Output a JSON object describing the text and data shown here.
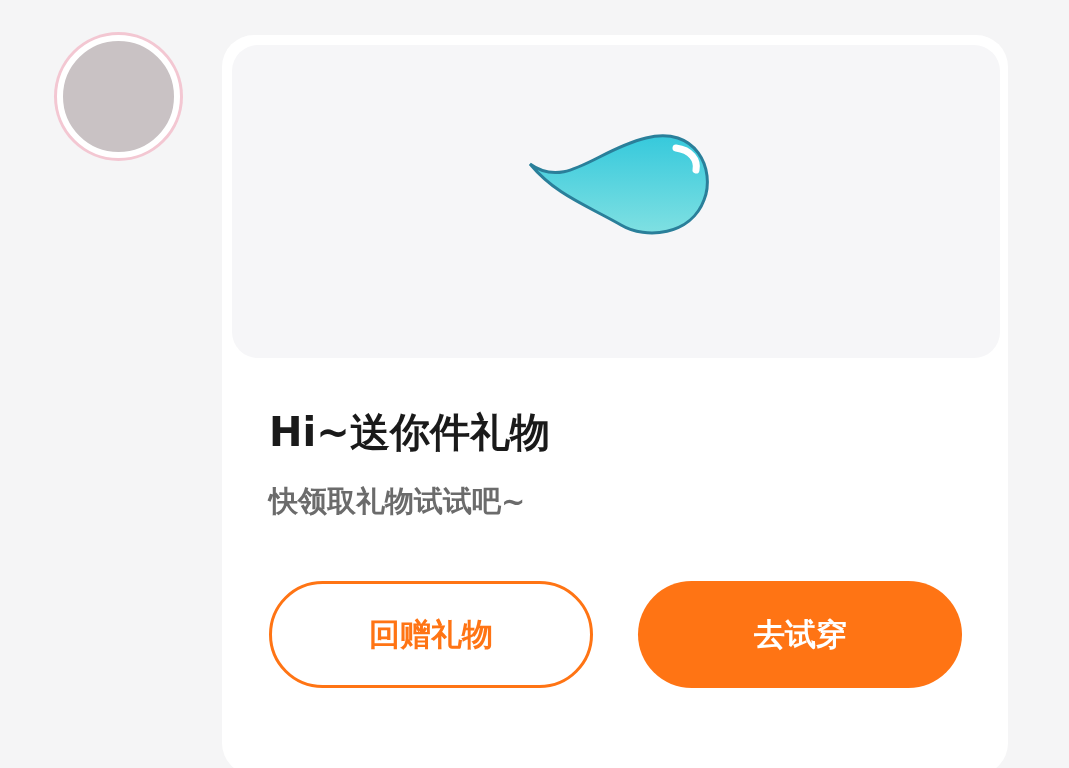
{
  "title": "Hi~送你件礼物",
  "subtitle": "快领取礼物试试吧~",
  "buttons": [
    {
      "label": "回赠礼物",
      "kind": "outline"
    },
    {
      "label": "去试穿",
      "kind": "filled"
    }
  ]
}
